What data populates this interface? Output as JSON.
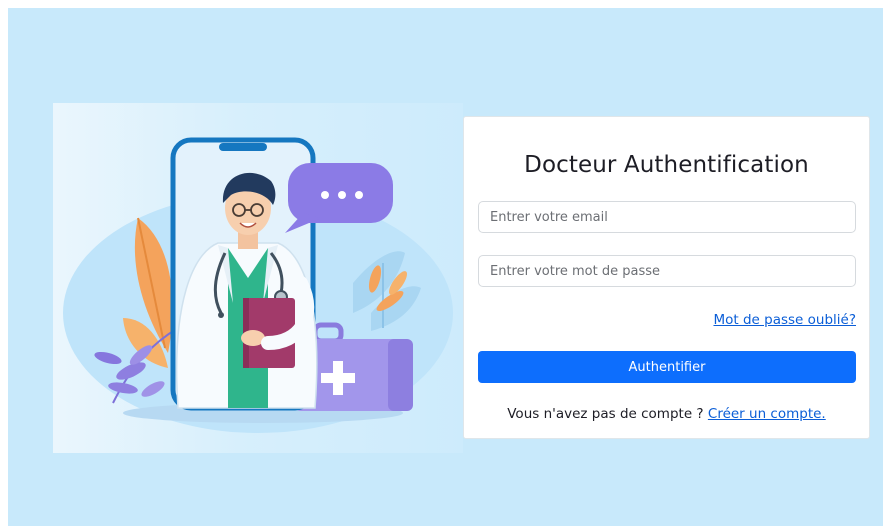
{
  "login": {
    "title": "Docteur Authentification",
    "email_placeholder": "Entrer votre email",
    "password_placeholder": "Entrer votre mot de passe",
    "forgot_password": "Mot de passe oublié?",
    "submit_label": "Authentifier",
    "no_account_text": "Vous n'avez pas de compte ?",
    "create_account_link": "Créer un compte."
  },
  "illustration": {
    "subject": "doctor-on-phone",
    "chat_bubble_text": "• • •"
  },
  "colors": {
    "page_background": "#c8e9fb",
    "primary": "#0d6efd",
    "link": "#0b5ed7",
    "phone_frame": "#1577c0",
    "chat_bubble": "#8b7be6",
    "medical_kit": "#9f93ea"
  }
}
